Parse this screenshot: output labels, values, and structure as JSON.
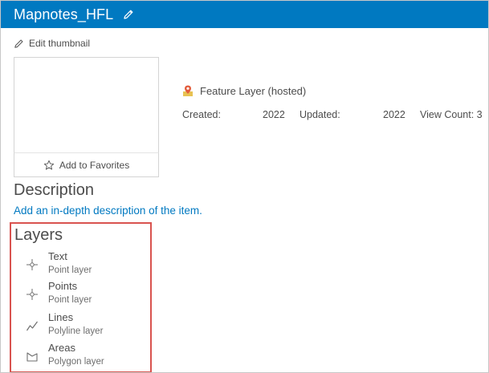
{
  "header": {
    "title": "Mapnotes_HFL",
    "bg_color": "#0079c1"
  },
  "thumbnail": {
    "edit_label": "Edit thumbnail",
    "favorites_label": "Add to Favorites"
  },
  "item": {
    "type_label": "Feature Layer (hosted)",
    "created_label": "Created:",
    "created_value": "2022",
    "updated_label": "Updated:",
    "updated_value": "2022",
    "view_count_label": "View Count: 3"
  },
  "description": {
    "heading": "Description",
    "link_text": "Add an in-depth description of the item."
  },
  "layers": {
    "heading": "Layers",
    "highlight_color": "#d9534f",
    "items": [
      {
        "name": "Text",
        "type": "Point layer",
        "icon": "point-icon"
      },
      {
        "name": "Points",
        "type": "Point layer",
        "icon": "point-icon"
      },
      {
        "name": "Lines",
        "type": "Polyline layer",
        "icon": "polyline-icon"
      },
      {
        "name": "Areas",
        "type": "Polygon layer",
        "icon": "polygon-icon"
      }
    ]
  }
}
